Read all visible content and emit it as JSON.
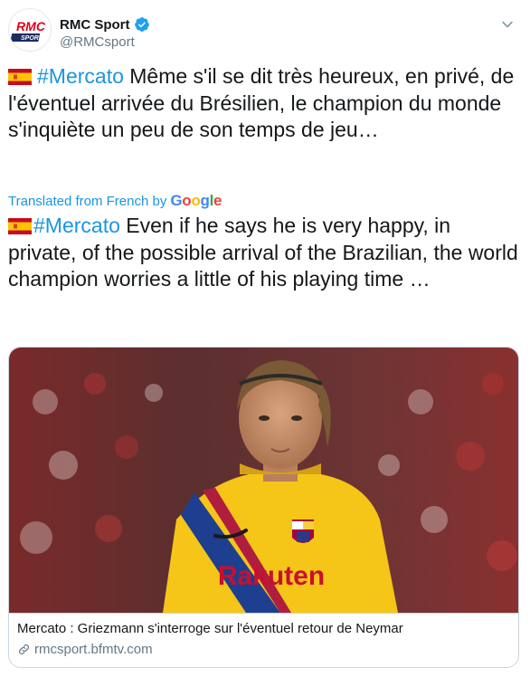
{
  "author": {
    "display_name": "RMC Sport",
    "handle": "@RMCsport",
    "avatar_text_top": "RMC",
    "avatar_text_bottom": "SPORT"
  },
  "tweet": {
    "hashtag": "#Mercato",
    "original_text": " Même s'il se dit très heureux, en privé, de l'éventuel arrivée du Brésilien, le champion du monde s'inquiète un peu de son temps de jeu…",
    "translated_label": "Translated from French by",
    "translator_brand": "Google",
    "translated_text": " Even if he says he is very happy, in private, of the possible arrival of the Brazilian, the world champion worries a little of his playing time …"
  },
  "card": {
    "title": "Mercato : Griezmann s'interroge sur l'éventuel retour de Neymar",
    "domain": "rmcsport.bfmtv.com",
    "shirt_sponsor": "Rakuten"
  },
  "colors": {
    "link_blue": "#1b95e0",
    "verified_blue": "#1da1f2",
    "secondary_text": "#657786",
    "jersey_yellow": "#f5c518"
  },
  "icons": {
    "verified": "verified-badge-icon",
    "caret": "chevron-down-icon",
    "flag": "spain-flag-icon",
    "link": "link-icon"
  }
}
